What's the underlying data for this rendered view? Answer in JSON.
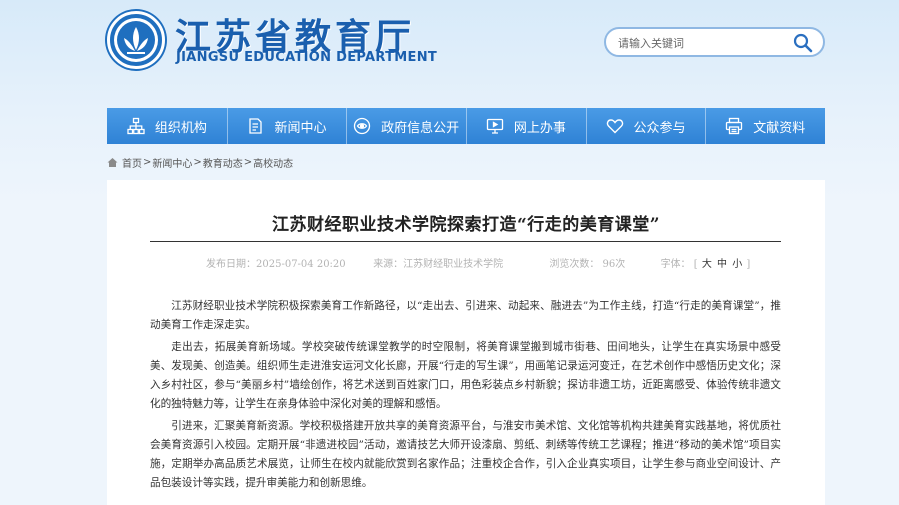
{
  "site": {
    "name_cn": "江苏省教育厅",
    "name_en": "JIANGSU EDUCATION DEPARTMENT",
    "logo_icon": "education-emblem",
    "brand_color": "#1a5fae"
  },
  "search": {
    "placeholder": "请输入关键词",
    "icon": "search-icon"
  },
  "nav": {
    "items": [
      {
        "label": "组织机构",
        "icon": "org-chart-icon"
      },
      {
        "label": "新闻中心",
        "icon": "document-edit-icon"
      },
      {
        "label": "政府信息公开",
        "icon": "eye-icon"
      },
      {
        "label": "网上办事",
        "icon": "monitor-icon"
      },
      {
        "label": "公众参与",
        "icon": "heart-icon"
      },
      {
        "label": "文献资料",
        "icon": "printer-icon"
      }
    ],
    "color": "#2f82d5"
  },
  "breadcrumb": {
    "items": [
      "首页",
      "新闻中心",
      "教育动态",
      "高校动态"
    ],
    "separator": ">"
  },
  "article": {
    "title": "江苏财经职业技术学院探索打造“行走的美育课堂”",
    "meta": {
      "date": "发布日期：2025-07-04 20:20",
      "source": "来源：江苏财经职业技术学院",
      "views": "浏览次数：  96次",
      "font_label": "字体：",
      "font_open": "[",
      "font_large": "大",
      "font_medium": "中",
      "font_small": "小",
      "font_close": "]"
    },
    "paragraphs": [
      "江苏财经职业技术学院积极探索美育工作新路径，以“走出去、引进来、动起来、融进去”为工作主线，打造“行走的美育课堂”，推动美育工作走深走实。",
      "走出去，拓展美育新场域。学校突破传统课堂教学的时空限制，将美育课堂搬到城市街巷、田间地头，让学生在真实场景中感受美、发现美、创造美。组织师生走进淮安运河文化长廊，开展“行走的写生课”，用画笔记录运河变迁，在艺术创作中感悟历史文化；深入乡村社区，参与“美丽乡村”墙绘创作，将艺术送到百姓家门口，用色彩装点乡村新貌；探访非遗工坊，近距离感受、体验传统非遗文化的独特魅力等，让学生在亲身体验中深化对美的理解和感悟。",
      "引进来，汇聚美育新资源。学校积极搭建开放共享的美育资源平台，与淮安市美术馆、文化馆等机构共建美育实践基地，将优质社会美育资源引入校园。定期开展“非遗进校园”活动，邀请技艺大师开设漆扇、剪纸、刺绣等传统工艺课程；推进“移动的美术馆”项目实施，定期举办高品质艺术展览，让师生在校内就能欣赏到名家作品；注重校企合作，引入企业真实项目，让学生参与商业空间设计、产品包装设计等实践，提升审美能力和创新思维。"
    ]
  }
}
